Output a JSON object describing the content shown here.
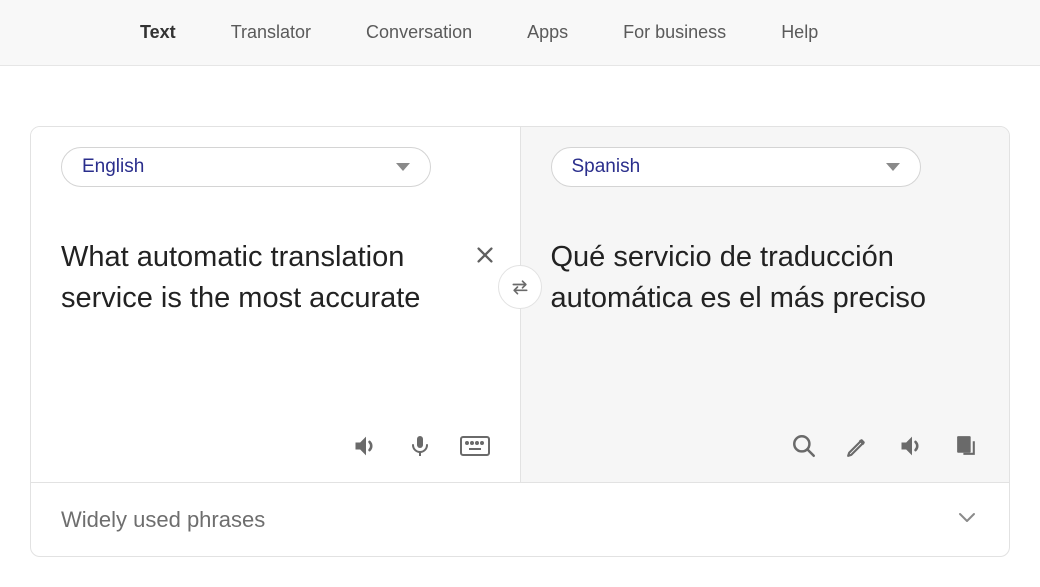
{
  "nav": {
    "items": [
      {
        "label": "Text",
        "active": true
      },
      {
        "label": "Translator",
        "active": false
      },
      {
        "label": "Conversation",
        "active": false
      },
      {
        "label": "Apps",
        "active": false
      },
      {
        "label": "For business",
        "active": false
      },
      {
        "label": "Help",
        "active": false
      }
    ]
  },
  "source": {
    "language": "English",
    "text": "What automatic translation service is the most accurate"
  },
  "target": {
    "language": "Spanish",
    "text": "Qué servicio de traducción automática es el más preciso"
  },
  "footer": {
    "phrases_label": "Widely used phrases"
  }
}
